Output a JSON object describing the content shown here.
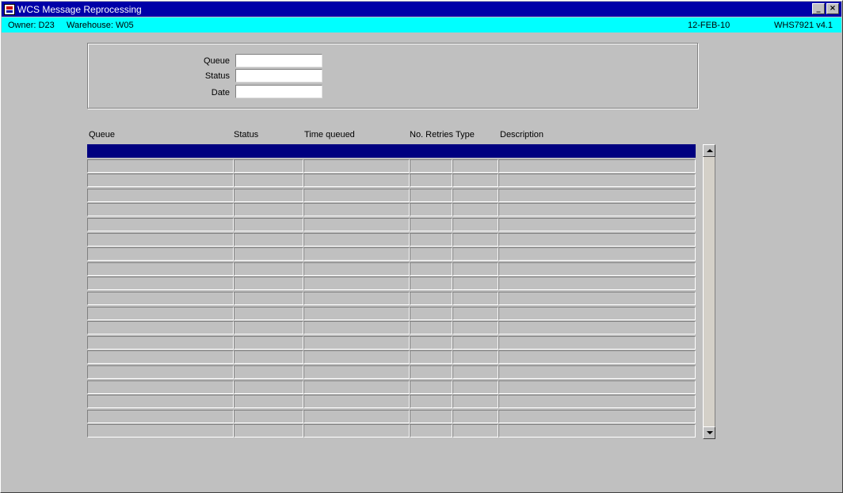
{
  "window": {
    "title": "WCS Message Reprocessing",
    "minimize_glyph": "_",
    "close_glyph": "×"
  },
  "status_bar": {
    "owner": "Owner:  D23",
    "warehouse": "Warehouse:  W05",
    "date": "12-FEB-10",
    "version": "WHS7921  v4.1",
    "background": "#00ffff"
  },
  "query": {
    "queue_label": "Queue",
    "status_label": "Status",
    "date_label": "Date",
    "queue_value": "",
    "status_value": "",
    "date_value": ""
  },
  "table": {
    "columns": [
      "Queue",
      "Status",
      "Time queued",
      "No. Retries",
      "Type",
      "Description"
    ],
    "rows": [
      [
        "",
        "",
        "",
        "",
        "",
        ""
      ],
      [
        "",
        "",
        "",
        "",
        "",
        ""
      ],
      [
        "",
        "",
        "",
        "",
        "",
        ""
      ],
      [
        "",
        "",
        "",
        "",
        "",
        ""
      ],
      [
        "",
        "",
        "",
        "",
        "",
        ""
      ],
      [
        "",
        "",
        "",
        "",
        "",
        ""
      ],
      [
        "",
        "",
        "",
        "",
        "",
        ""
      ],
      [
        "",
        "",
        "",
        "",
        "",
        ""
      ],
      [
        "",
        "",
        "",
        "",
        "",
        ""
      ],
      [
        "",
        "",
        "",
        "",
        "",
        ""
      ],
      [
        "",
        "",
        "",
        "",
        "",
        ""
      ],
      [
        "",
        "",
        "",
        "",
        "",
        ""
      ],
      [
        "",
        "",
        "",
        "",
        "",
        ""
      ],
      [
        "",
        "",
        "",
        "",
        "",
        ""
      ],
      [
        "",
        "",
        "",
        "",
        "",
        ""
      ],
      [
        "",
        "",
        "",
        "",
        "",
        ""
      ],
      [
        "",
        "",
        "",
        "",
        "",
        ""
      ],
      [
        "",
        "",
        "",
        "",
        "",
        ""
      ],
      [
        "",
        "",
        "",
        "",
        "",
        ""
      ],
      [
        "",
        "",
        "",
        "",
        "",
        ""
      ]
    ],
    "selected_row": 0,
    "selection_color": "#000080"
  },
  "icons": {
    "app": "oracle-forms-icon",
    "scroll_up": "arrow-up-icon",
    "scroll_down": "arrow-down-icon"
  }
}
